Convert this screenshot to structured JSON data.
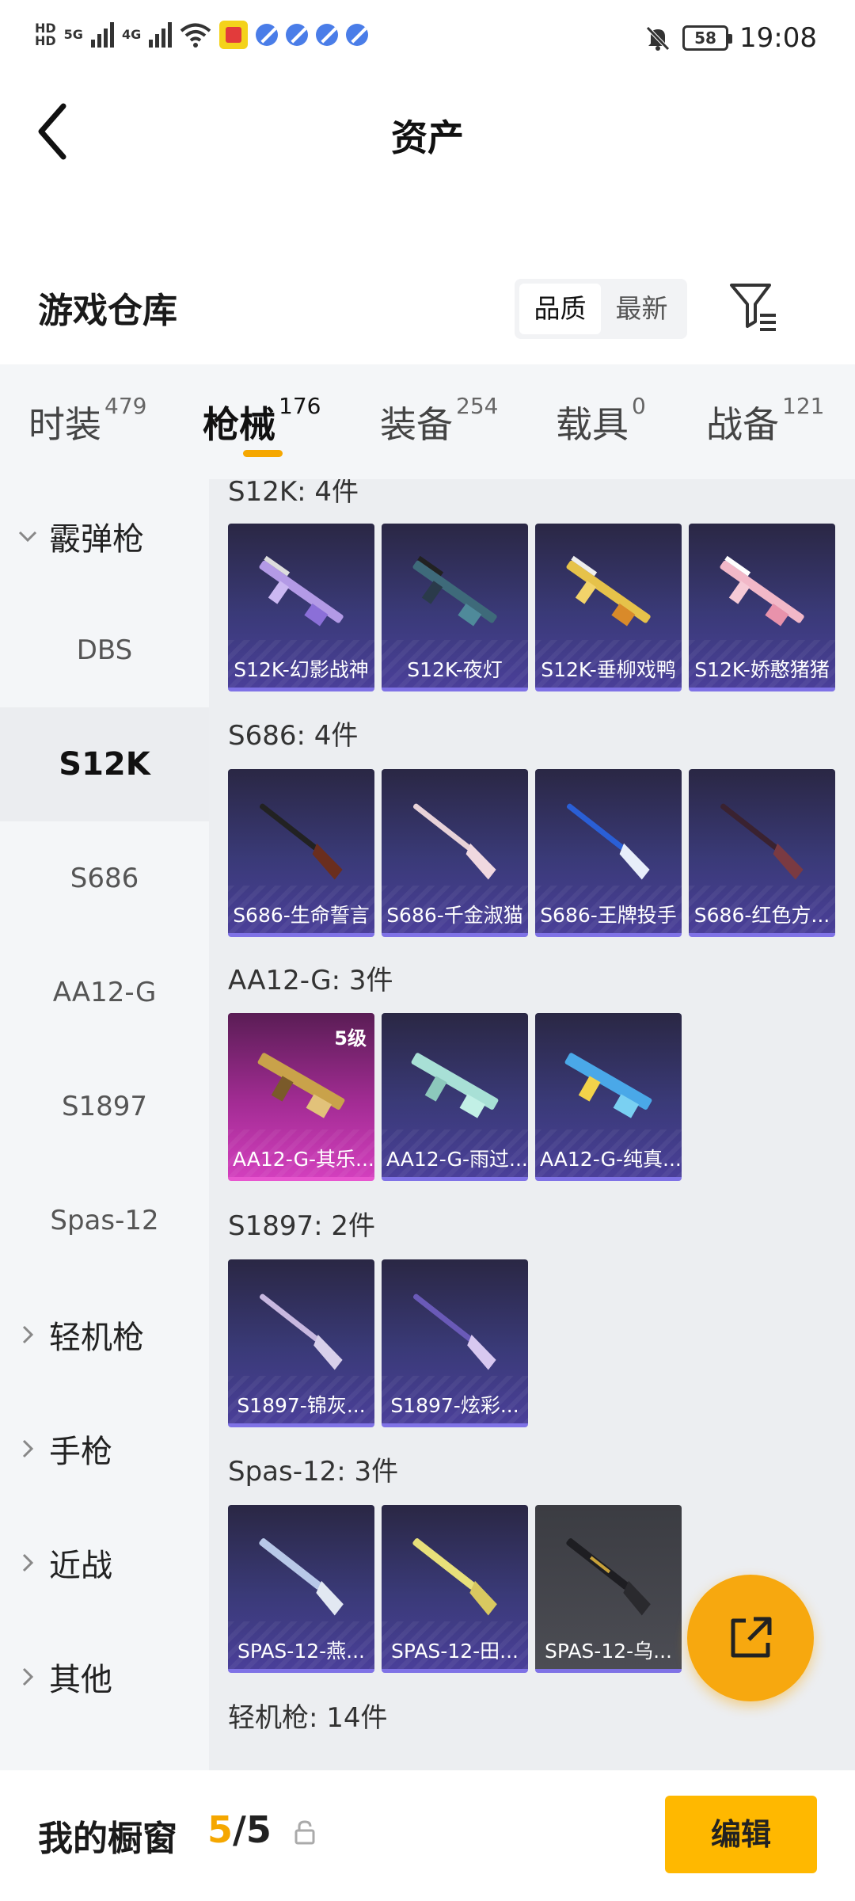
{
  "status_bar": {
    "hd_top": "HD",
    "hd_bottom": "HD",
    "net_1": "5G",
    "net_2": "4G",
    "battery": "58",
    "time": "19:08"
  },
  "header": {
    "title": "资产"
  },
  "warehouse": {
    "title": "游戏仓库",
    "sort_options": [
      "品质",
      "最新"
    ],
    "active_sort": "品质"
  },
  "tabs": [
    {
      "label": "时装",
      "count": "479"
    },
    {
      "label": "枪械",
      "count": "176"
    },
    {
      "label": "装备",
      "count": "254"
    },
    {
      "label": "载具",
      "count": "0"
    },
    {
      "label": "战备",
      "count": "121"
    }
  ],
  "sidebar": {
    "group_open": "霰弹枪",
    "items": [
      "DBS",
      "S12K",
      "S686",
      "AA12-G",
      "S1897",
      "Spas-12"
    ],
    "selected": "S12K",
    "groups_closed": [
      "轻机枪",
      "手枪",
      "近战",
      "其他"
    ]
  },
  "sections": [
    {
      "title": "S12K: 4件",
      "cards": [
        {
          "label": "S12K-幻影战神"
        },
        {
          "label": "S12K-夜灯"
        },
        {
          "label": "S12K-垂柳戏鸭"
        },
        {
          "label": "S12K-娇憨猪猪"
        }
      ]
    },
    {
      "title": "S686: 4件",
      "cards": [
        {
          "label": "S686-生命誓言"
        },
        {
          "label": "S686-千金淑猫"
        },
        {
          "label": "S686-王牌投手"
        },
        {
          "label": "S686-红色方..."
        }
      ]
    },
    {
      "title": "AA12-G: 3件",
      "cards": [
        {
          "label": "AA12-G-其乐...",
          "level": "5级"
        },
        {
          "label": "AA12-G-雨过..."
        },
        {
          "label": "AA12-G-纯真..."
        }
      ]
    },
    {
      "title": "S1897: 2件",
      "cards": [
        {
          "label": "S1897-锦灰..."
        },
        {
          "label": "S1897-炫彩..."
        }
      ]
    },
    {
      "title": "Spas-12: 3件",
      "cards": [
        {
          "label": "SPAS-12-燕..."
        },
        {
          "label": "SPAS-12-田..."
        },
        {
          "label": "SPAS-12-乌..."
        }
      ]
    },
    {
      "title": "轻机枪: 14件",
      "cards": []
    }
  ],
  "bottom_bar": {
    "title": "我的橱窗",
    "count_current": "5",
    "count_sep": "/",
    "count_total": "5",
    "edit_label": "编辑"
  },
  "colors": {
    "accent": "#ffb800",
    "card_purple": "#3a3a78",
    "card_pink": "#a32c94"
  }
}
